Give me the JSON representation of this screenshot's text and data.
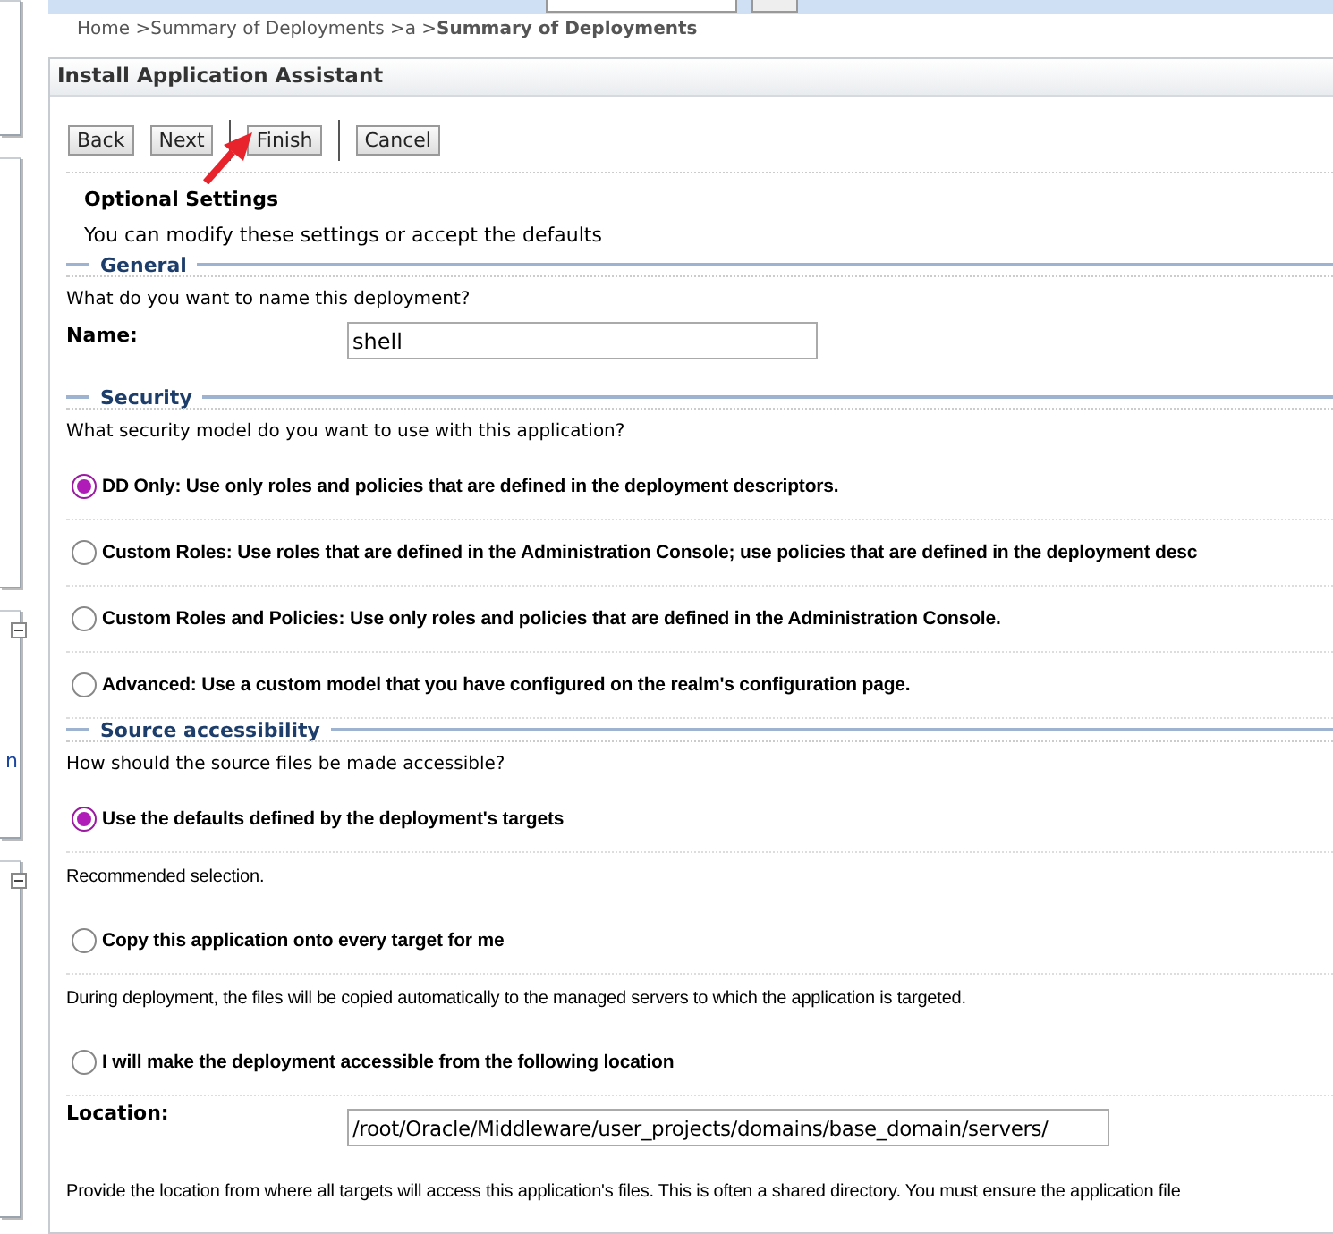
{
  "breadcrumb": [
    {
      "label": "Home >",
      "current": false
    },
    {
      "label": "Summary of Deployments >",
      "current": false
    },
    {
      "label": "a >",
      "current": false
    },
    {
      "label": "Summary of Deployments",
      "current": true
    }
  ],
  "sidebar": {
    "link_fragment": "n"
  },
  "panel": {
    "title": "Install Application Assistant",
    "buttons": [
      {
        "label": "Back",
        "separator_before": false
      },
      {
        "label": "Next",
        "separator_before": false
      },
      {
        "label": "Finish",
        "separator_before": true
      },
      {
        "label": "Cancel",
        "separator_before": true
      }
    ],
    "heading": "Optional Settings",
    "intro": "You can modify these settings or accept the defaults",
    "sections": [
      {
        "legend": "General",
        "items": [
          {
            "kind": "question",
            "text": "What do you want to name this deployment?"
          },
          {
            "kind": "short_field",
            "label": "Name:",
            "value": "shell"
          }
        ]
      },
      {
        "legend": "Security",
        "items": [
          {
            "kind": "question",
            "text": "What security model do you want to use with this application?"
          },
          {
            "kind": "radio",
            "text": "DD Only: Use only roles and policies that are defined in the deployment descriptors.",
            "selected": true
          },
          {
            "kind": "radio",
            "text": "Custom Roles: Use roles that are defined in the Administration Console; use policies that are defined in the deployment desc",
            "selected": false
          },
          {
            "kind": "radio",
            "text": "Custom Roles and Policies: Use only roles and policies that are defined in the Administration Console.",
            "selected": false
          },
          {
            "kind": "radio",
            "text": "Advanced: Use a custom model that you have configured on the realm's configuration page.",
            "selected": false
          }
        ]
      },
      {
        "legend": "Source accessibility",
        "items": [
          {
            "kind": "question",
            "text": "How should the source files be made accessible?"
          },
          {
            "kind": "radio",
            "text": "Use the defaults defined by the deployment's targets",
            "selected": true
          },
          {
            "kind": "note",
            "text": "Recommended selection."
          },
          {
            "kind": "radio",
            "text": "Copy this application onto every target for me",
            "selected": false
          },
          {
            "kind": "note",
            "text": "During deployment, the files will be copied automatically to the managed servers to which the application is targeted."
          },
          {
            "kind": "radio",
            "text": "I will make the deployment accessible from the following location",
            "selected": false
          },
          {
            "kind": "long_field",
            "label": "Location:",
            "value": "/root/Oracle/Middleware/user_projects/domains/base_domain/servers/"
          },
          {
            "kind": "note",
            "text": "Provide the location from where all targets will access this application's files. This is often a shared directory. You must ensure the application file"
          }
        ]
      }
    ]
  }
}
